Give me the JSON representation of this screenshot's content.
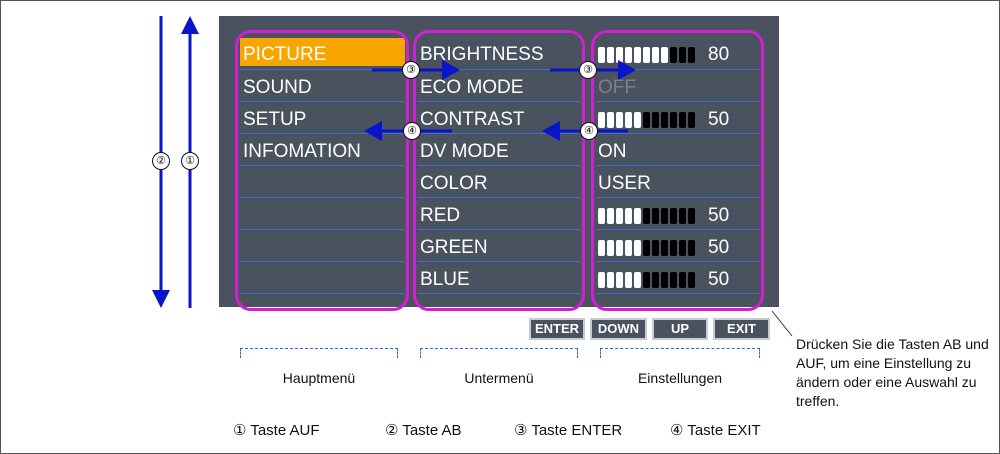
{
  "main_menu": {
    "items": [
      {
        "label": "PICTURE",
        "selected": true
      },
      {
        "label": "SOUND"
      },
      {
        "label": "SETUP"
      },
      {
        "label": "INFOMATION"
      }
    ]
  },
  "sub_menu": {
    "items": [
      {
        "label": "BRIGHTNESS"
      },
      {
        "label": "ECO MODE"
      },
      {
        "label": "CONTRAST"
      },
      {
        "label": "DV MODE"
      },
      {
        "label": "COLOR"
      },
      {
        "label": "RED"
      },
      {
        "label": "GREEN"
      },
      {
        "label": "BLUE"
      }
    ]
  },
  "settings": {
    "rows": [
      {
        "type": "bar",
        "value": "80",
        "filled": 8,
        "total": 11
      },
      {
        "type": "text",
        "value": "OFF",
        "dimmed": true
      },
      {
        "type": "bar",
        "value": "50",
        "filled": 5,
        "total": 11
      },
      {
        "type": "text",
        "value": "ON"
      },
      {
        "type": "text",
        "value": "USER"
      },
      {
        "type": "bar",
        "value": "50",
        "filled": 5,
        "total": 11
      },
      {
        "type": "bar",
        "value": "50",
        "filled": 5,
        "total": 11
      },
      {
        "type": "bar",
        "value": "50",
        "filled": 5,
        "total": 11
      }
    ]
  },
  "buttons": {
    "enter": "ENTER",
    "down": "DOWN",
    "up": "UP",
    "exit": "EXIT"
  },
  "captions": {
    "main": "Hauptmenü",
    "sub": "Untermenü",
    "settings": "Einstellungen"
  },
  "note": "Drücken Sie die Tasten AB und AUF, um eine Einstellung zu ändern oder eine Auswahl zu treffen.",
  "markers": {
    "one": "①",
    "two": "②",
    "three": "③",
    "four": "④"
  },
  "legend": [
    {
      "label": "① Taste AUF"
    },
    {
      "label": "② Taste AB"
    },
    {
      "label": "③ Taste ENTER"
    },
    {
      "label": "④ Taste EXIT"
    }
  ],
  "colors": {
    "osd_background": "#4a5260",
    "selection": "#f7a600",
    "highlight": "#d21fd2",
    "arrow": "#0a14c8",
    "divider": "#3f6fd0"
  }
}
